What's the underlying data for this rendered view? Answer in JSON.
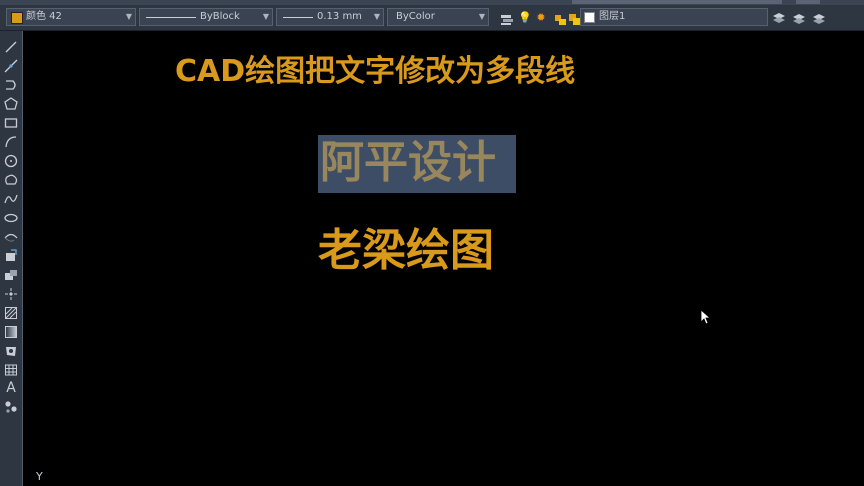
{
  "toolbar": {
    "color_label": "颜色 42",
    "color_swatch": "#d99a14",
    "linetype_label": "ByBlock",
    "lineweight_label": "0.13 mm",
    "plotstyle_label": "ByColor",
    "layer_label": "图层1"
  },
  "left_toolbar": {
    "text_tool_glyph": "A"
  },
  "canvas": {
    "title": "CAD绘图把文字修改为多段线",
    "text1": "阿平设计",
    "text2": "老梁绘图",
    "ucs_y": "Y",
    "text_color": "#d99a1c",
    "highlight_color": "#3d4d66"
  }
}
